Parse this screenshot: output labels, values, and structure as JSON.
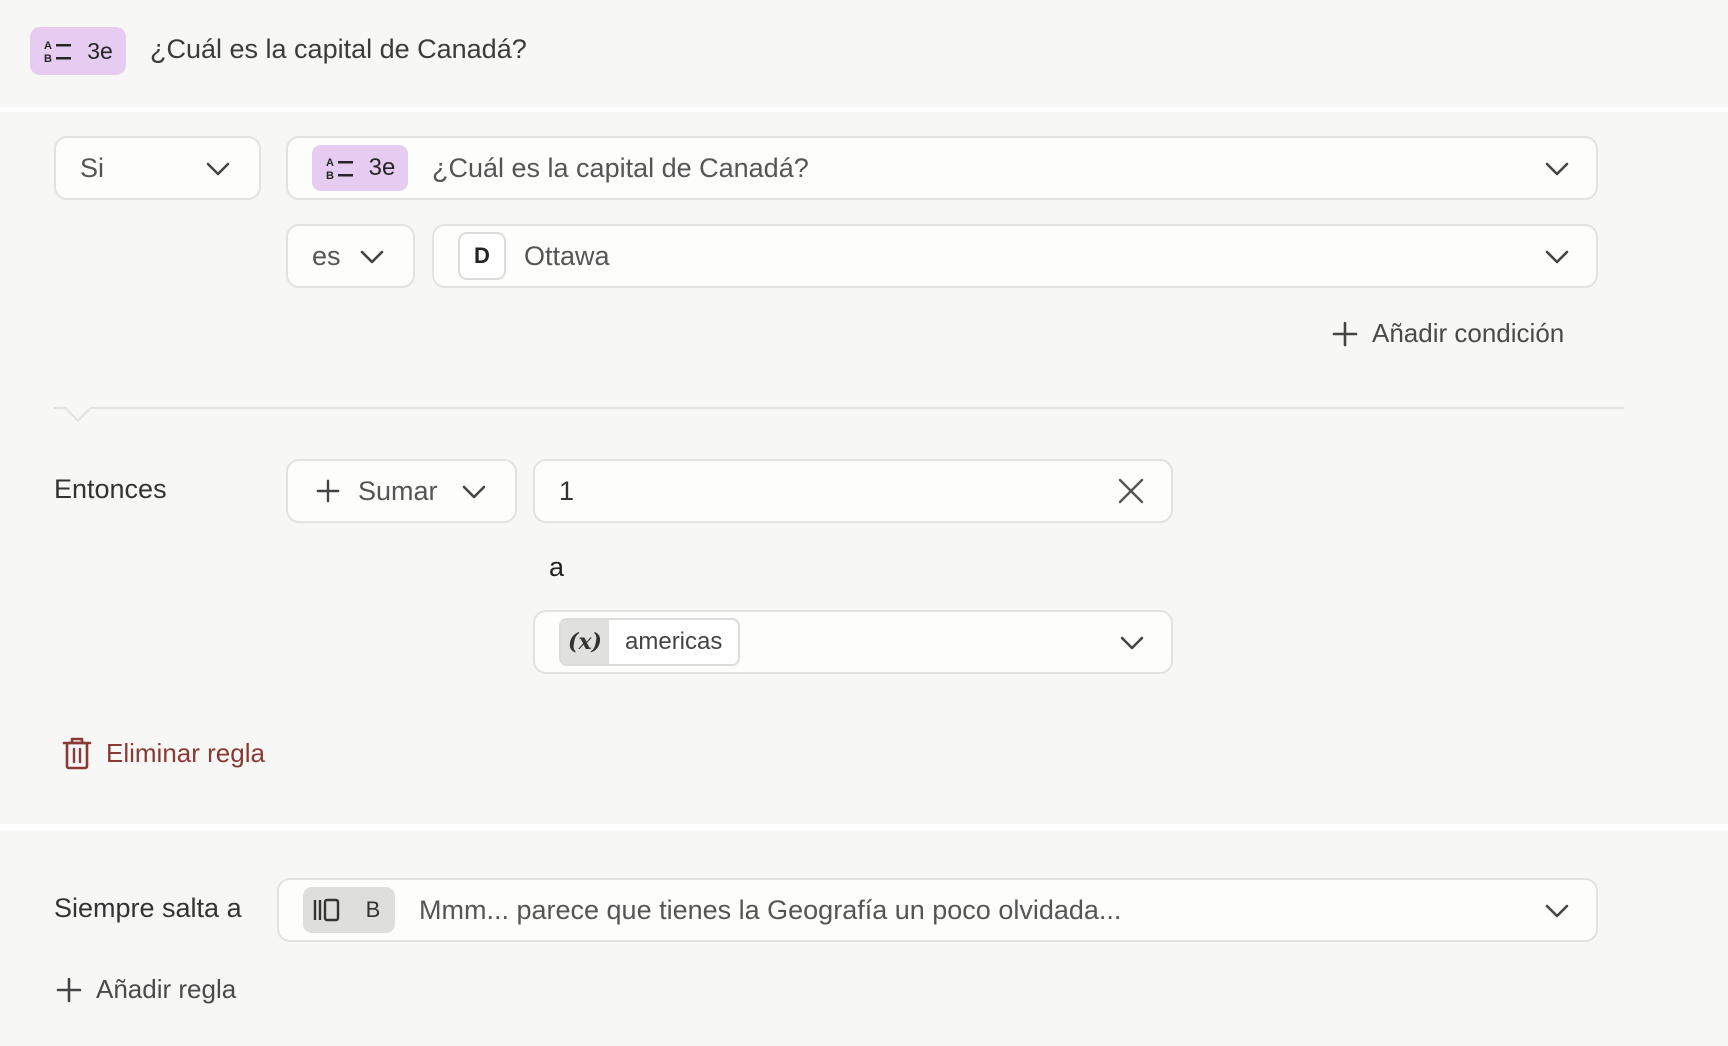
{
  "header": {
    "question_label": "3e",
    "question_title": "¿Cuál es la capital de Canadá?"
  },
  "condition": {
    "if_select": "Si",
    "question_label": "3e",
    "question_title": "¿Cuál es la capital de Canadá?",
    "operator": "es",
    "answer_letter": "D",
    "answer_value": "Ottawa",
    "add_condition_label": "Añadir condición"
  },
  "action": {
    "then_label": "Entonces",
    "operation": "Sumar",
    "amount": "1",
    "connector": "a",
    "variable_symbol": "(x)",
    "variable_name": "americas"
  },
  "delete_rule_label": "Eliminar regla",
  "always_jump": {
    "label": "Siempre salta a",
    "target_letter": "B",
    "target_title": "Mmm... parece que tienes la Geografía un poco olvidada..."
  },
  "add_rule_label": "Añadir regla",
  "colors": {
    "panel_bg": "#f7f7f6",
    "question_badge": "#e6ccf0",
    "delete_red": "#8a3a35"
  }
}
